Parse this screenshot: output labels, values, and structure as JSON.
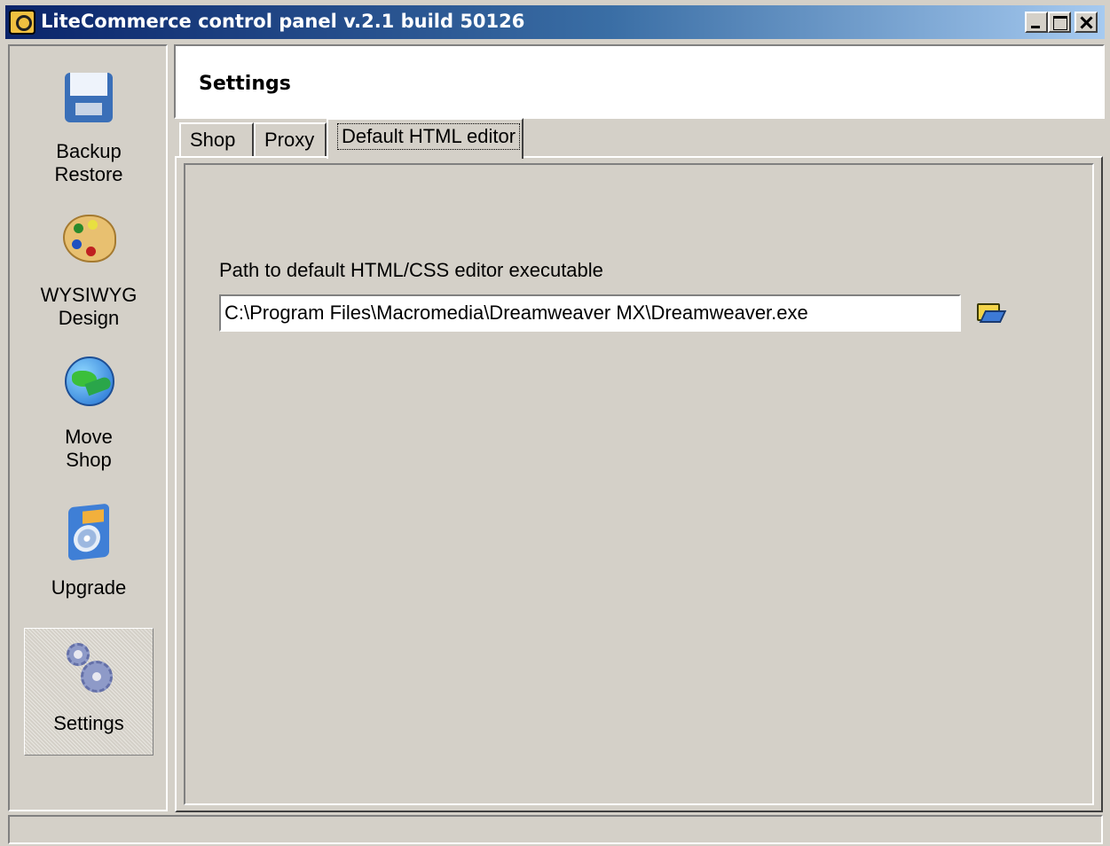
{
  "window": {
    "title": "LiteCommerce control panel v.2.1 build 50126"
  },
  "sidebar": {
    "items": [
      {
        "label": "Backup\nRestore",
        "icon": "disk-icon"
      },
      {
        "label": "WYSIWYG\nDesign",
        "icon": "palette-icon"
      },
      {
        "label": "Move\nShop",
        "icon": "globe-icon"
      },
      {
        "label": "Upgrade",
        "icon": "cd-icon"
      },
      {
        "label": "Settings",
        "icon": "gears-icon",
        "selected": true
      }
    ]
  },
  "header": {
    "title": "Settings"
  },
  "tabs": [
    {
      "label": "Shop"
    },
    {
      "label": "Proxy"
    },
    {
      "label": "Default HTML editor",
      "active": true
    }
  ],
  "editor_panel": {
    "path_label": "Path to default HTML/CSS editor executable",
    "path_value": "C:\\Program Files\\Macromedia\\Dreamweaver MX\\Dreamweaver.exe",
    "browse_icon": "open-folder-icon"
  },
  "colors": {
    "titlebar_start": "#0a246a",
    "titlebar_end": "#a6caf0",
    "face": "#d4d0c8"
  }
}
